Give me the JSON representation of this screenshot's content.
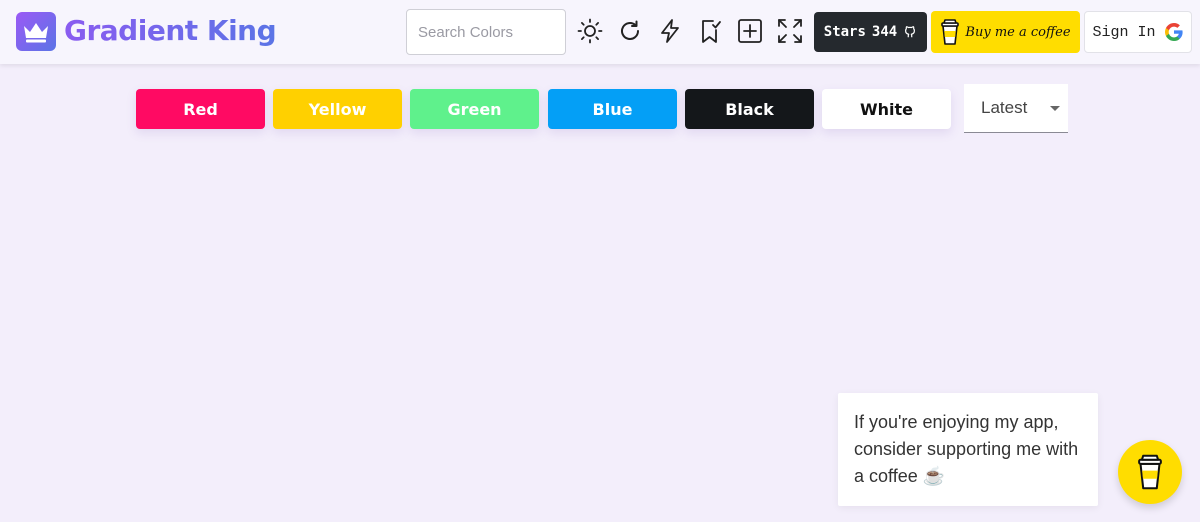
{
  "app": {
    "title": "Gradient King",
    "logo_icon": "crown-icon"
  },
  "header": {
    "search": {
      "placeholder": "Search Colors",
      "value": ""
    },
    "tools": [
      {
        "name": "theme-toggle",
        "icon": "sun-icon"
      },
      {
        "name": "refresh",
        "icon": "refresh-icon"
      },
      {
        "name": "random",
        "icon": "lightning-icon"
      },
      {
        "name": "saved",
        "icon": "bookmark-check-icon"
      },
      {
        "name": "add",
        "icon": "plus-square-icon"
      },
      {
        "name": "fullscreen",
        "icon": "expand-icon"
      }
    ],
    "stars": {
      "label": "Stars",
      "count": "344",
      "icon": "github-icon"
    },
    "coffee": {
      "label": "Buy me a coffee",
      "icon": "coffee-cup-icon"
    },
    "signin": {
      "label": "Sign In",
      "icon": "google-icon"
    }
  },
  "filters": {
    "chips": [
      {
        "label": "Red",
        "bg": "#ff0a63",
        "fg": "#ffffff"
      },
      {
        "label": "Yellow",
        "bg": "#ffd000",
        "fg": "#ffffff"
      },
      {
        "label": "Green",
        "bg": "#5ff18c",
        "fg": "#ffffff"
      },
      {
        "label": "Blue",
        "bg": "#049ff6",
        "fg": "#ffffff"
      },
      {
        "label": "Black",
        "bg": "#14171a",
        "fg": "#ffffff"
      },
      {
        "label": "White",
        "bg": "#ffffff",
        "fg": "#111111"
      }
    ],
    "sort": {
      "selected": "Latest"
    }
  },
  "support_popup": {
    "text": "If you're enjoying my app, consider supporting me with a coffee ☕"
  },
  "colors": {
    "background": "#f3eefb",
    "accent_gradient_start": "#9b59f5",
    "accent_gradient_end": "#5b74e6",
    "coffee_yellow": "#ffdd00"
  }
}
